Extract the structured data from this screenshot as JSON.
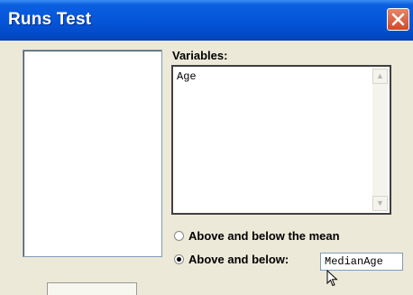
{
  "window": {
    "title": "Runs Test"
  },
  "variables": {
    "label": "Variables:",
    "items": [
      "Age"
    ]
  },
  "options": {
    "mean_label": "Above and below the mean",
    "custom_label": "Above and below:",
    "selected": "custom"
  },
  "cutoff": {
    "value": "MedianAge"
  },
  "icons": {
    "close": "close-icon",
    "cursor": "mouse-cursor-icon"
  },
  "colors": {
    "titlebar": "#0556d8",
    "close": "#d9552f",
    "dialog_bg": "#ece9d8"
  }
}
